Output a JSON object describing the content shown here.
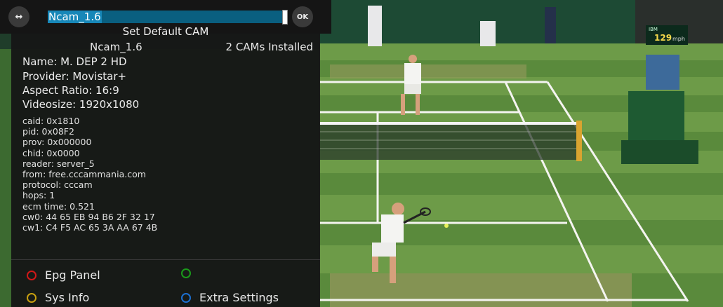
{
  "topbar": {
    "arrows_icon": "↔",
    "selected_cam": "Ncam_1.6",
    "ok_label": "OK"
  },
  "header": {
    "title": "Set Default CAM",
    "cam_name": "Ncam_1.6",
    "cams_installed": "2  CAMs Installed"
  },
  "channel_info": {
    "name": "Name: M. DEP 2 HD",
    "provider": "Provider: Movistar+",
    "aspect": "Aspect Ratio: 16:9",
    "videosize": "Videosize: 1920x1080"
  },
  "ecm_info": [
    "caid: 0x1810",
    "pid: 0x08F2",
    "prov: 0x000000",
    "chid: 0x0000",
    "reader: server_5",
    "from: free.cccammania.com",
    "protocol: cccam",
    "hops: 1",
    "ecm time: 0.521",
    "cw0: 44 65 EB 94 B6 2F 32 17",
    "cw1: C4 F5 AC 65 3A AA 67 4B"
  ],
  "buttons": {
    "red": "Epg Panel",
    "green": "",
    "yellow": "Sys Info",
    "blue": "Extra Settings"
  },
  "colors": {
    "red": "#d01818",
    "green": "#1a9a1a",
    "yellow": "#c8a010",
    "blue": "#1c6fd0",
    "selection": "#0a5f80"
  },
  "scene": {
    "speed_value": "129",
    "speed_unit": "mph",
    "scoreboard_brand": "IBM"
  }
}
